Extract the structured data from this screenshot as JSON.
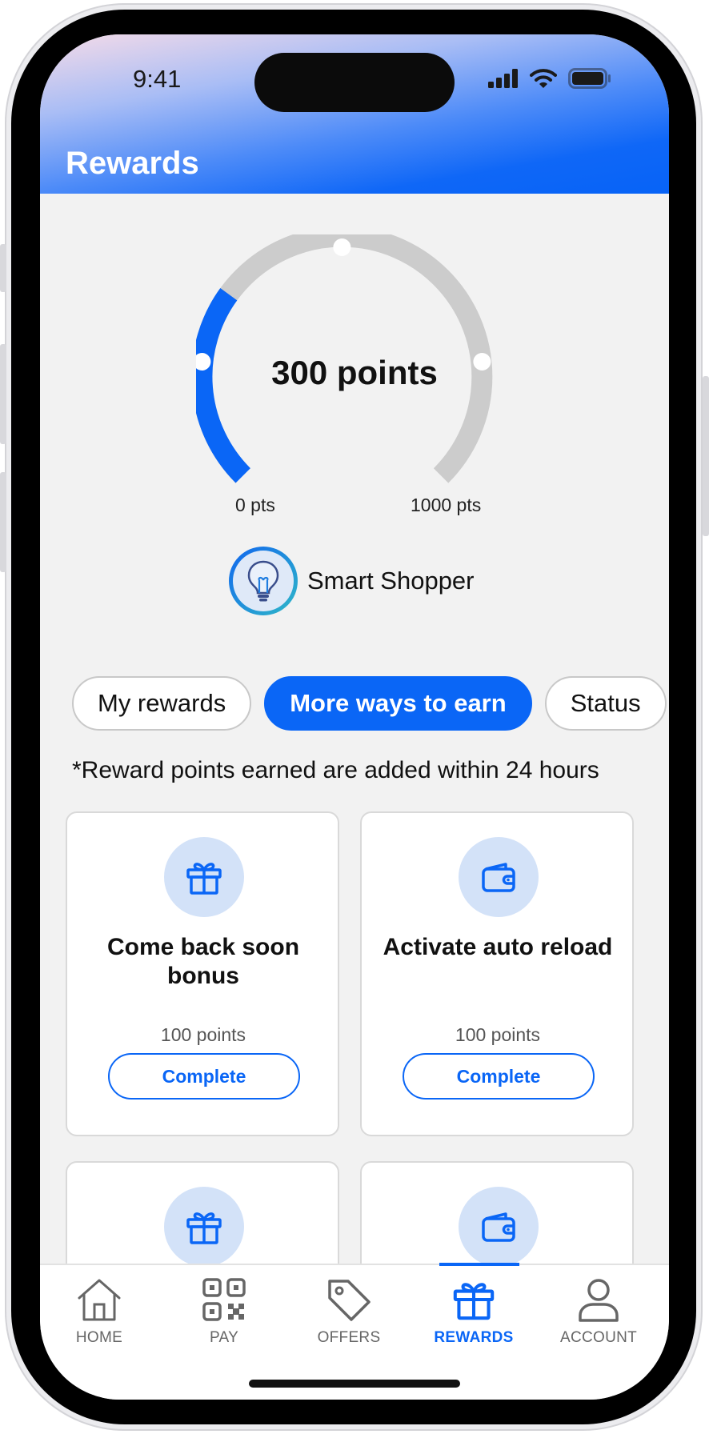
{
  "status_bar": {
    "time": "9:41"
  },
  "header": {
    "title": "Rewards"
  },
  "points": {
    "label": "300 points",
    "value": 300,
    "min": 0,
    "max": 1000,
    "min_label": "0 pts",
    "max_label": "1000 pts"
  },
  "tier": {
    "name": "Smart Shopper",
    "icon": "lightbulb-icon"
  },
  "tabs": [
    {
      "label": "My rewards",
      "active": false
    },
    {
      "label": "More ways to earn",
      "active": true
    },
    {
      "label": "Status",
      "active": false
    }
  ],
  "note": "*Reward points earned are added within 24 hours",
  "cards": [
    {
      "icon": "gift-icon",
      "title": "Come back soon bonus",
      "points": "100 points",
      "action": "Complete"
    },
    {
      "icon": "wallet-icon",
      "title": "Activate auto reload",
      "points": "100 points",
      "action": "Complete"
    },
    {
      "icon": "gift-icon"
    },
    {
      "icon": "wallet-icon"
    }
  ],
  "nav": [
    {
      "label": "HOME",
      "icon": "home-icon",
      "active": false
    },
    {
      "label": "PAY",
      "icon": "qr-code-icon",
      "active": false
    },
    {
      "label": "OFFERS",
      "icon": "tag-icon",
      "active": false
    },
    {
      "label": "REWARDS",
      "icon": "gift-icon",
      "active": true
    },
    {
      "label": "ACCOUNT",
      "icon": "person-icon",
      "active": false
    }
  ],
  "colors": {
    "accent": "#0a66f6",
    "track": "#cccccc",
    "icon_bg": "#d3e2f8"
  }
}
